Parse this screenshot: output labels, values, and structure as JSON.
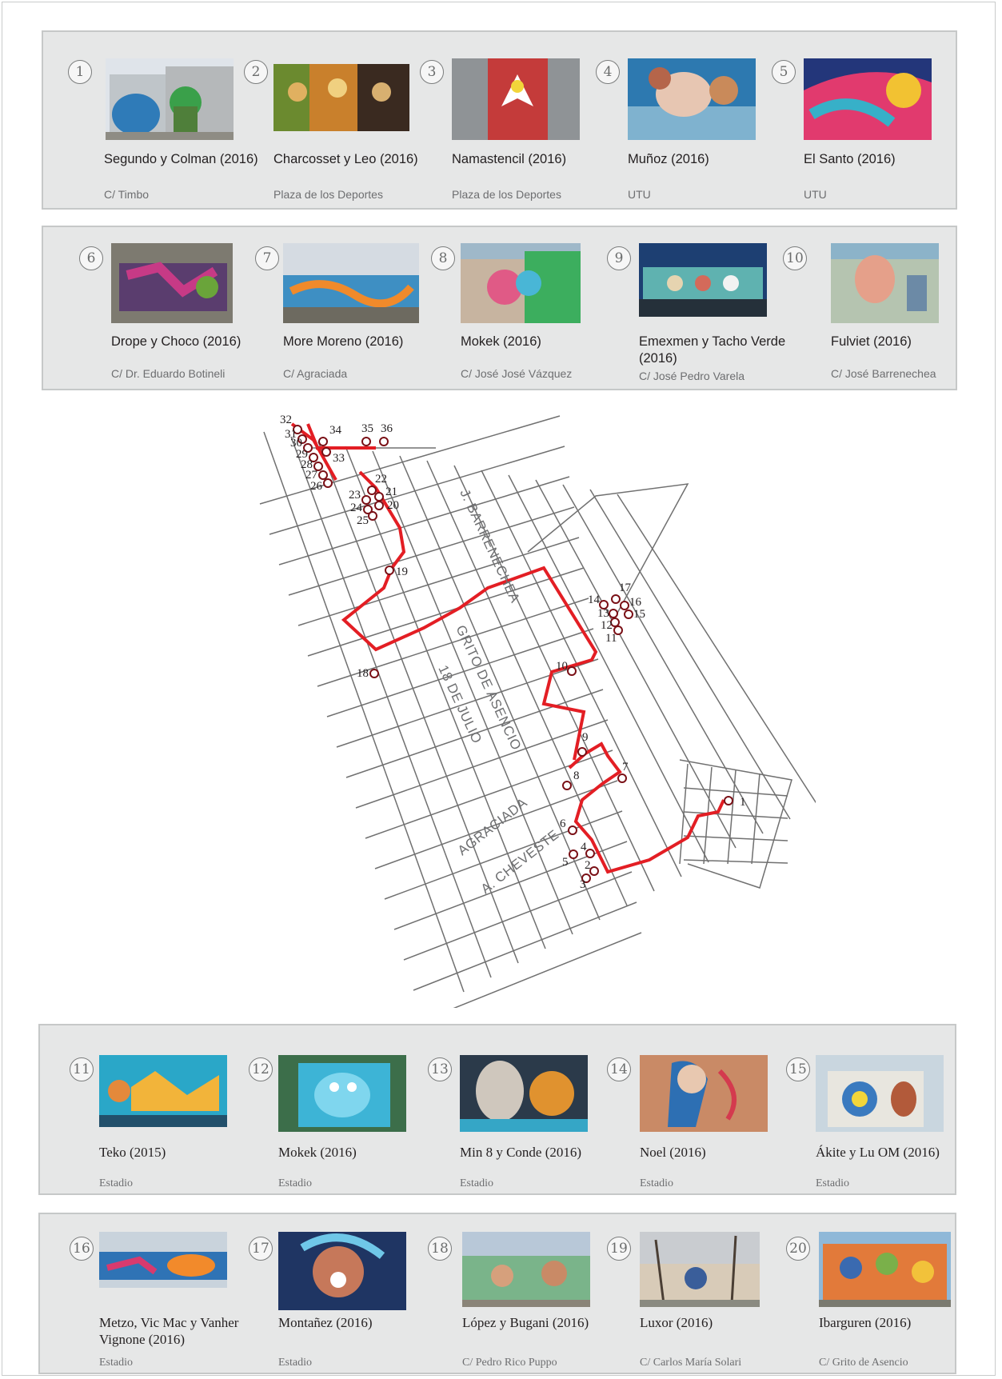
{
  "colors": {
    "panel": "#e6e7e7",
    "panel_border": "#c6c8c8",
    "route": "#e31e24",
    "marker": "#7a1016",
    "street_line": "#707070"
  },
  "panels": [
    {
      "cards": [
        {
          "number": "1",
          "title": "Segundo y Colman (2016)",
          "location": "C/ Timbo"
        },
        {
          "number": "2",
          "title": "Charcosset y Leo (2016)",
          "location": "Plaza de los Deportes"
        },
        {
          "number": "3",
          "title": "Namastencil (2016)",
          "location": "Plaza de los Deportes"
        },
        {
          "number": "4",
          "title": "Muñoz (2016)",
          "location": "UTU"
        },
        {
          "number": "5",
          "title": "El Santo (2016)",
          "location": "UTU"
        }
      ]
    },
    {
      "cards": [
        {
          "number": "6",
          "title": "Drope y Choco (2016)",
          "location": "C/ Dr. Eduardo Botineli"
        },
        {
          "number": "7",
          "title": "More Moreno (2016)",
          "location": "C/ Agraciada"
        },
        {
          "number": "8",
          "title": "Mokek (2016)",
          "location": "C/ José José Vázquez"
        },
        {
          "number": "9",
          "title": "Emexmen y Tacho Verde (2016)",
          "location": "C/ José Pedro Varela"
        },
        {
          "number": "10",
          "title": "Fulviet (2016)",
          "location": "C/ José Barrenechea"
        }
      ]
    },
    {
      "cards": [
        {
          "number": "11",
          "title": "Teko (2015)",
          "location": "Estadio"
        },
        {
          "number": "12",
          "title": "Mokek (2016)",
          "location": "Estadio"
        },
        {
          "number": "13",
          "title": "Min 8 y Conde (2016)",
          "location": "Estadio"
        },
        {
          "number": "14",
          "title": "Noel (2016)",
          "location": "Estadio"
        },
        {
          "number": "15",
          "title": "Ákite y Lu OM (2016)",
          "location": "Estadio"
        }
      ]
    },
    {
      "cards": [
        {
          "number": "16",
          "title": "Metzo, Vic Mac y Vanher Vignone (2016)",
          "location": "Estadio"
        },
        {
          "number": "17",
          "title": "Montañez (2016)",
          "location": "Estadio"
        },
        {
          "number": "18",
          "title": "López y Bugani (2016)",
          "location": "C/ Pedro Rico Puppo"
        },
        {
          "number": "19",
          "title": "Luxor (2016)",
          "location": "C/ Carlos María Solari"
        },
        {
          "number": "20",
          "title": "Ibarguren (2016)",
          "location": "C/ Grito de Asencio"
        }
      ]
    }
  ],
  "map": {
    "street_labels": {
      "barrenechea": "J. BARRENECHEA",
      "grito": "GRITO DE ASENCIO",
      "julio": "18 DE JULIO",
      "agraciada": "AGRACIADA",
      "cheveste": "A. CHEVESTE"
    },
    "markers": [
      "1",
      "2",
      "3",
      "4",
      "5",
      "6",
      "7",
      "8",
      "9",
      "10",
      "11",
      "12",
      "13",
      "14",
      "15",
      "16",
      "17",
      "18",
      "19",
      "20",
      "21",
      "22",
      "23",
      "24",
      "25",
      "26",
      "27",
      "28",
      "29",
      "30",
      "31",
      "32",
      "33",
      "34",
      "35",
      "36"
    ]
  }
}
